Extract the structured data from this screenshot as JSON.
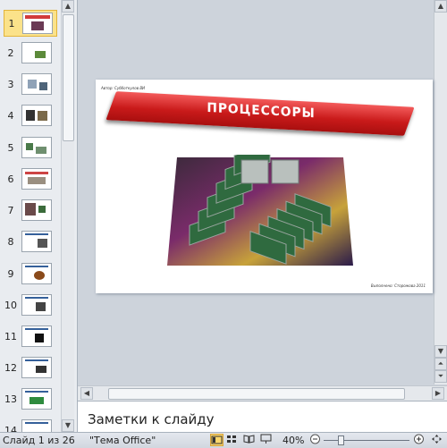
{
  "thumbnails": [
    {
      "num": "1",
      "selected": true
    },
    {
      "num": "2"
    },
    {
      "num": "3"
    },
    {
      "num": "4"
    },
    {
      "num": "5"
    },
    {
      "num": "6"
    },
    {
      "num": "7"
    },
    {
      "num": "8"
    },
    {
      "num": "9"
    },
    {
      "num": "10"
    },
    {
      "num": "11"
    },
    {
      "num": "12"
    },
    {
      "num": "13"
    },
    {
      "num": "14"
    }
  ],
  "slide": {
    "author": "Автор: Субботкулов ВИ",
    "title": "ПРОЦЕССОРЫ",
    "executed_by": "Выполнено: Сторожова 2011"
  },
  "notes": {
    "placeholder": "Заметки к слайду"
  },
  "status": {
    "slide_info": "Слайд 1 из 26",
    "theme": "\"Тема Office\"",
    "zoom": "40%"
  },
  "colors": {
    "banner": "#c91a1a",
    "selected_thumb": "#fbe28a"
  }
}
